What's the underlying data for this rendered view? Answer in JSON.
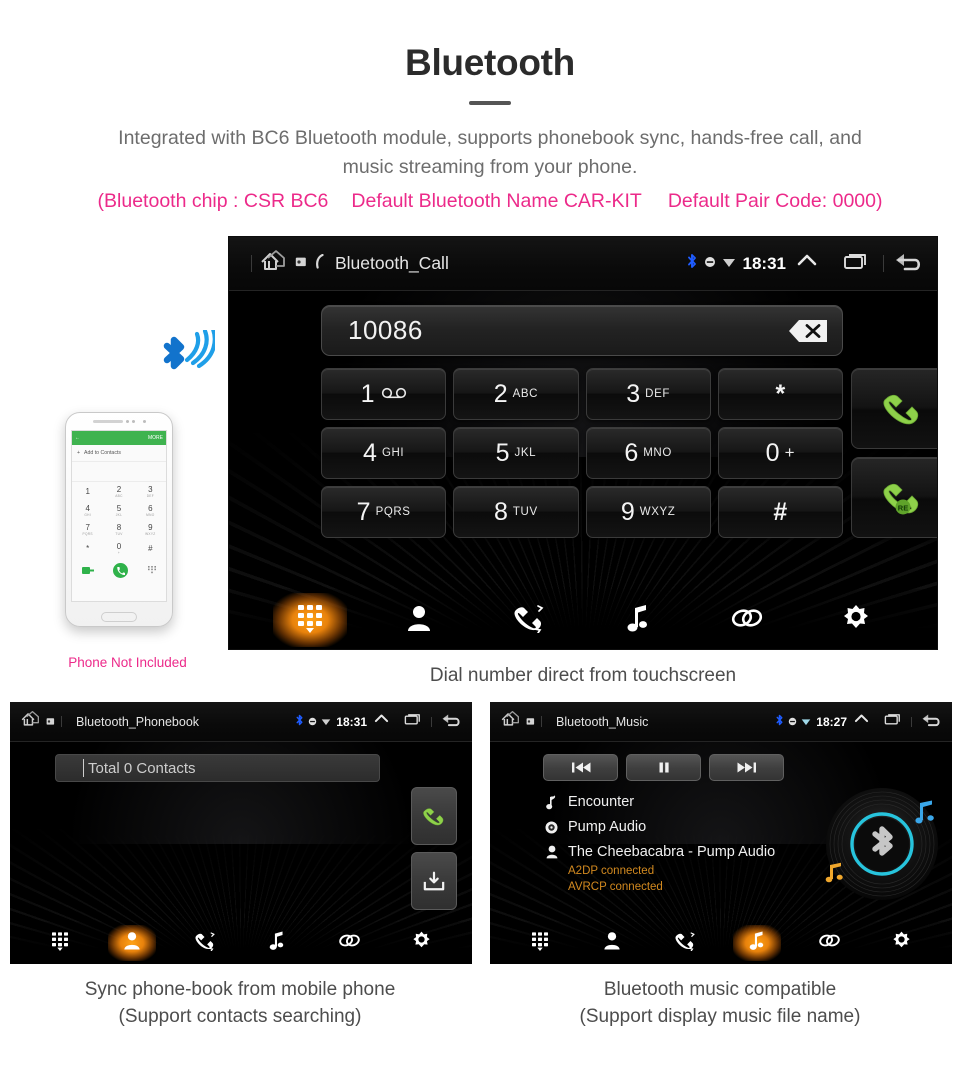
{
  "header": {
    "title": "Bluetooth",
    "description_line1": "Integrated with BC6 Bluetooth module, supports phonebook sync, hands-free call, and",
    "description_line2": "music streaming from your phone.",
    "spec_chip": "(Bluetooth chip : CSR BC6",
    "spec_name": "Default Bluetooth Name CAR-KIT",
    "spec_pair": "Default Pair Code: 0000)",
    "accent_pink": "#ec2a8a",
    "body_gray": "#6d6d6d"
  },
  "phone_mock": {
    "note": "Phone Not Included",
    "appbar_more": "MORE",
    "add_contacts": "Add to Contacts",
    "keys": [
      {
        "digit": "1",
        "letters": ""
      },
      {
        "digit": "2",
        "letters": "ABC"
      },
      {
        "digit": "3",
        "letters": "DEF"
      },
      {
        "digit": "4",
        "letters": "GHI"
      },
      {
        "digit": "5",
        "letters": "JKL"
      },
      {
        "digit": "6",
        "letters": "MNO"
      },
      {
        "digit": "7",
        "letters": "PQRS"
      },
      {
        "digit": "8",
        "letters": "TUV"
      },
      {
        "digit": "9",
        "letters": "WXYZ"
      },
      {
        "digit": "*",
        "letters": ""
      },
      {
        "digit": "0",
        "letters": "+"
      },
      {
        "digit": "#",
        "letters": ""
      }
    ]
  },
  "dialer": {
    "title": "Bluetooth_Call",
    "time": "18:31",
    "number": "10086",
    "caption": "Dial number direct from touchscreen",
    "keys": [
      {
        "digit": "1",
        "letters": "",
        "icon": "voicemail-icon"
      },
      {
        "digit": "2",
        "letters": "ABC",
        "icon": ""
      },
      {
        "digit": "3",
        "letters": "DEF",
        "icon": ""
      },
      {
        "digit": "*",
        "letters": "",
        "icon": ""
      },
      {
        "digit": "4",
        "letters": "GHI",
        "icon": ""
      },
      {
        "digit": "5",
        "letters": "JKL",
        "icon": ""
      },
      {
        "digit": "6",
        "letters": "MNO",
        "icon": ""
      },
      {
        "digit": "0",
        "letters": "+",
        "icon": ""
      },
      {
        "digit": "7",
        "letters": "PQRS",
        "icon": ""
      },
      {
        "digit": "8",
        "letters": "TUV",
        "icon": ""
      },
      {
        "digit": "9",
        "letters": "WXYZ",
        "icon": ""
      },
      {
        "digit": "#",
        "letters": "",
        "icon": ""
      }
    ],
    "redial_badge": "RE"
  },
  "phonebook": {
    "title": "Bluetooth_Phonebook",
    "time": "18:31",
    "search_value": "Total 0 Contacts",
    "caption_line1": "Sync phone-book from mobile phone",
    "caption_line2": "(Support contacts searching)"
  },
  "music": {
    "title": "Bluetooth_Music",
    "time": "18:27",
    "track": "Encounter",
    "album": "Pump Audio",
    "artist": "The Cheebacabra - Pump Audio",
    "status_a2dp": "A2DP connected",
    "status_avrcp": "AVRCP connected",
    "status_color": "#d2891f",
    "caption_line1": "Bluetooth music compatible",
    "caption_line2": "(Support display music file name)"
  },
  "navbar": {
    "items": [
      {
        "name": "keypad",
        "icon": "keypad-icon"
      },
      {
        "name": "contacts",
        "icon": "contact-icon"
      },
      {
        "name": "call-log",
        "icon": "call-history-icon"
      },
      {
        "name": "music",
        "icon": "music-note-icon"
      },
      {
        "name": "pair",
        "icon": "link-icon"
      },
      {
        "name": "settings",
        "icon": "gear-icon"
      }
    ]
  },
  "colors": {
    "active_orange": "#f59b14",
    "call_green": "#8ed14a",
    "bluetooth_blue": "#1f7ae0",
    "vinyl_cyan": "#27c4dd"
  }
}
